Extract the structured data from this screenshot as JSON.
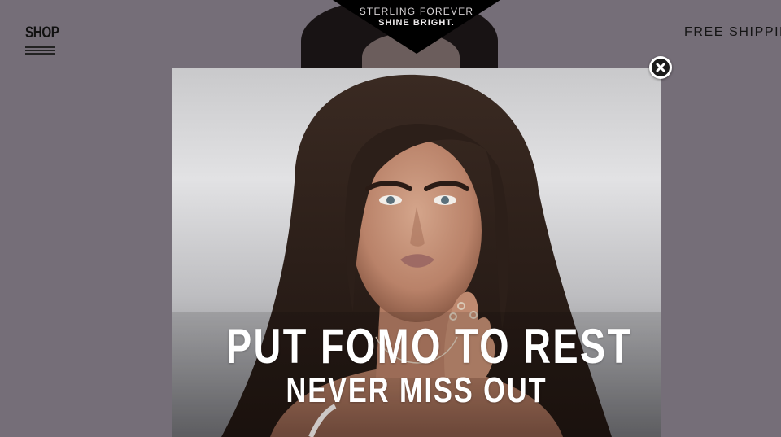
{
  "header": {
    "shop_label": "SHOP",
    "shipping_text": "FREE SHIPPING",
    "menu_icon": "hamburger-icon"
  },
  "logo": {
    "line1": "STERLING FOREVER",
    "line2": "SHINE BRIGHT."
  },
  "popup": {
    "headline": "PUT FOMO TO REST",
    "subheadline": "NEVER MISS OUT",
    "close_icon": "close-icon"
  },
  "colors": {
    "overlay_background": "#756e78",
    "logo_badge": "#000000",
    "headline_text": "#ffffff",
    "close_button_fill": "#1b1b1b"
  }
}
